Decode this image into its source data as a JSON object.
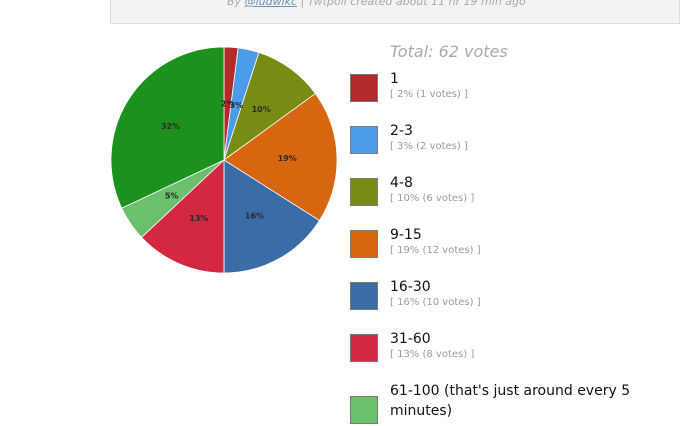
{
  "byline": {
    "prefix": "By",
    "handle": "@ludwikc",
    "suffix": "| Twtpoll created about 11 hr 19 min ago"
  },
  "total_label": "Total: 62 votes",
  "chart_data": {
    "type": "pie",
    "title": "",
    "total_votes": 62,
    "slices": [
      {
        "label": "1",
        "percent": 2,
        "votes": 1,
        "pie_label": "2%",
        "color": "#b22a2a",
        "detail": "[ 2% (1 votes) ]"
      },
      {
        "label": "2-3",
        "percent": 3,
        "votes": 2,
        "pie_label": "3%",
        "color": "#4a9be8",
        "detail": "[ 3% (2 votes) ]"
      },
      {
        "label": "4-8",
        "percent": 10,
        "votes": 6,
        "pie_label": "10%",
        "color": "#788c13",
        "detail": "[ 10% (6 votes) ]"
      },
      {
        "label": "9-15",
        "percent": 19,
        "votes": 12,
        "pie_label": "19%",
        "color": "#d6660f",
        "detail": "[ 19% (12 votes) ]"
      },
      {
        "label": "16-30",
        "percent": 16,
        "votes": 10,
        "pie_label": "16%",
        "color": "#3a6ca7",
        "detail": "[ 16% (10 votes) ]"
      },
      {
        "label": "31-60",
        "percent": 13,
        "votes": 8,
        "pie_label": "13%",
        "color": "#d42742",
        "detail": "[ 13% (8 votes) ]"
      },
      {
        "label": "61-100 (that's just around every 5 minutes)",
        "label_lines": [
          "61-100 (that's just around every 5",
          "minutes)"
        ],
        "percent": 5,
        "votes": 3,
        "pie_label": "5%",
        "color": "#6cbf6c",
        "detail": ""
      },
      {
        "label": "",
        "percent": 32,
        "votes": 20,
        "pie_label": "32%",
        "color": "#1c911c",
        "detail": ""
      }
    ]
  }
}
